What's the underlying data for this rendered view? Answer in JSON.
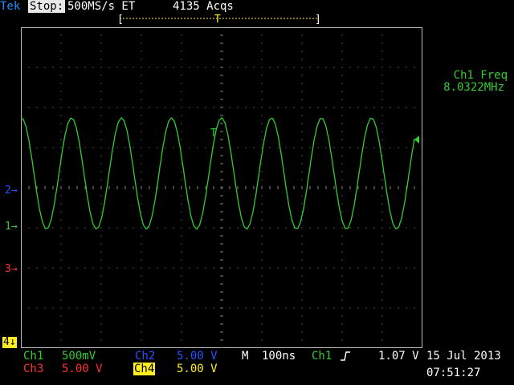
{
  "status": {
    "brand": "Tek",
    "state": "Stop:",
    "sample_rate": "500MS/s ET",
    "acquisitions": "4135 Acqs"
  },
  "record_bar": {
    "trigger_symbol": "T"
  },
  "measurement": {
    "label": "Ch1 Freq",
    "value": "8.0322MHz"
  },
  "markers": {
    "ch1": "1→",
    "ch2": "2→",
    "ch3": "3→",
    "ch4": "4↓"
  },
  "trigger_symbol_on_trace": "T",
  "bottom": {
    "ch1_name": "Ch1",
    "ch1_scale": "500mV",
    "ch2_name": "Ch2",
    "ch2_scale": "5.00 V",
    "ch3_name": "Ch3",
    "ch3_scale": "5.00 V",
    "ch4_name": "Ch4",
    "ch4_scale": "5.00 V",
    "horizontal_prefix": "M",
    "horizontal_scale": "100ns",
    "trigger_source": "Ch1",
    "trigger_slope_icon": "rising-edge-icon",
    "trigger_level": "1.07 V"
  },
  "clock": {
    "date": "15 Jul 2013",
    "time": "07:51:27"
  },
  "colors": {
    "ch1": "#33cc33",
    "ch2": "#2a50ff",
    "ch3": "#ff3030",
    "ch4": "#ffee22",
    "brand": "#1e90ff",
    "background": "#000000"
  },
  "waveform": {
    "channel": "Ch1",
    "cycles_on_screen": 8.03,
    "peak_level_divisions": 2.65,
    "trough_level_divisions": -0.1
  }
}
